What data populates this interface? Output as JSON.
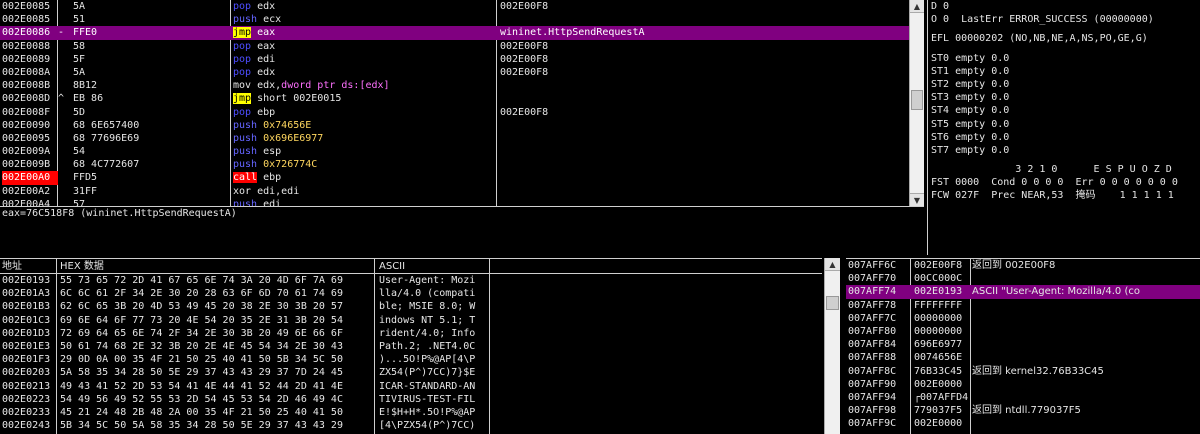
{
  "disasm": {
    "rows": [
      {
        "addr": "002E0085",
        "mark": "",
        "hex": "5A",
        "mnem": "pop",
        "kind": "pop",
        "ops": [
          {
            "t": " edx",
            "c": "plain"
          }
        ],
        "comment": "002E00F8"
      },
      {
        "addr": "002E0085",
        "mark": "",
        "hex": "51",
        "mnem": "push",
        "kind": "push",
        "ops": [
          {
            "t": " ecx",
            "c": "plain"
          }
        ],
        "comment": ""
      },
      {
        "addr": "002E0086",
        "mark": "-",
        "hex": "FFE0",
        "mnem": "jmp",
        "kind": "jmp",
        "ops": [
          {
            "t": " eax",
            "c": "plain"
          }
        ],
        "comment": "wininet.HttpSendRequestA",
        "selected": true
      },
      {
        "addr": "002E0088",
        "mark": "",
        "hex": "58",
        "mnem": "pop",
        "kind": "pop",
        "ops": [
          {
            "t": " eax",
            "c": "plain"
          }
        ],
        "comment": "002E00F8"
      },
      {
        "addr": "002E0089",
        "mark": "",
        "hex": "5F",
        "mnem": "pop",
        "kind": "pop",
        "ops": [
          {
            "t": " edi",
            "c": "plain"
          }
        ],
        "comment": "002E00F8"
      },
      {
        "addr": "002E008A",
        "mark": "",
        "hex": "5A",
        "mnem": "pop",
        "kind": "pop",
        "ops": [
          {
            "t": " edx",
            "c": "plain"
          }
        ],
        "comment": "002E00F8"
      },
      {
        "addr": "002E008B",
        "mark": "",
        "hex": "8B12",
        "mnem": "mov",
        "kind": "plain",
        "ops": [
          {
            "t": " edx,",
            "c": "plain"
          },
          {
            "t": "dword ptr ds:[edx]",
            "c": "mem"
          }
        ],
        "comment": ""
      },
      {
        "addr": "002E008D",
        "mark": "^",
        "hex": "EB 86",
        "mnem": "jmp",
        "kind": "jmp",
        "ops": [
          {
            "t": " short 002E0015",
            "c": "plain"
          }
        ],
        "comment": ""
      },
      {
        "addr": "002E008F",
        "mark": "",
        "hex": "5D",
        "mnem": "pop",
        "kind": "pop",
        "ops": [
          {
            "t": " ebp",
            "c": "plain"
          }
        ],
        "comment": "002E00F8"
      },
      {
        "addr": "002E0090",
        "mark": "",
        "hex": "68 6E657400",
        "mnem": "push",
        "kind": "push",
        "ops": [
          {
            "t": " 0x74656E",
            "c": "imm"
          }
        ],
        "comment": ""
      },
      {
        "addr": "002E0095",
        "mark": "",
        "hex": "68 77696E69",
        "mnem": "push",
        "kind": "push",
        "ops": [
          {
            "t": " 0x696E6977",
            "c": "imm"
          }
        ],
        "comment": ""
      },
      {
        "addr": "002E009A",
        "mark": "",
        "hex": "54",
        "mnem": "push",
        "kind": "push",
        "ops": [
          {
            "t": " esp",
            "c": "plain"
          }
        ],
        "comment": ""
      },
      {
        "addr": "002E009B",
        "mark": "",
        "hex": "68 4C772607",
        "mnem": "push",
        "kind": "push",
        "ops": [
          {
            "t": " 0x726774C",
            "c": "imm"
          }
        ],
        "comment": ""
      },
      {
        "addr": "002E00A0",
        "mark": "",
        "hex": "FFD5",
        "mnem": "call",
        "kind": "call",
        "ops": [
          {
            "t": " ebp",
            "c": "plain"
          }
        ],
        "comment": "",
        "addr_red": true
      },
      {
        "addr": "002E00A2",
        "mark": "",
        "hex": "31FF",
        "mnem": "xor",
        "kind": "plain",
        "ops": [
          {
            "t": " edi,edi",
            "c": "plain"
          }
        ],
        "comment": ""
      },
      {
        "addr": "002E00A4",
        "mark": "",
        "hex": "57",
        "mnem": "push",
        "kind": "push",
        "ops": [
          {
            "t": " edi",
            "c": "plain"
          }
        ],
        "comment": ""
      }
    ]
  },
  "info_line": "eax=76C518F8 (wininet.HttpSendRequestA)",
  "registers": {
    "lines_top": [
      "D 0",
      "O 0  LastErr ERROR_SUCCESS (00000000)"
    ],
    "efl": "EFL 00000202 (NO,NB,NE,A,NS,PO,GE,G)",
    "st": [
      "ST0 empty 0.0",
      "ST1 empty 0.0",
      "ST2 empty 0.0",
      "ST3 empty 0.0",
      "ST4 empty 0.0",
      "ST5 empty 0.0",
      "ST6 empty 0.0",
      "ST7 empty 0.0"
    ],
    "fpu_header": "              3 2 1 0      E S P U O Z D",
    "fst": "FST 0000  Cond 0 0 0 0  Err 0 0 0 0 0 0 0",
    "fcw_prefix": "FCW 027F  Prec NEAR,53  ",
    "fcw_mask_label": "掩码",
    "fcw_suffix": "    1 1 1 1 1"
  },
  "dump": {
    "header_addr": "地址",
    "header_hex": "HEX 数据",
    "header_ascii": "ASCII",
    "rows": [
      {
        "addr": "002E0193",
        "hex": "55 73 65 72 2D 41 67 65 6E 74 3A 20 4D 6F 7A 69",
        "ascii": "User-Agent: Mozi"
      },
      {
        "addr": "002E01A3",
        "hex": "6C 6C 61 2F 34 2E 30 20 28 63 6F 6D 70 61 74 69",
        "ascii": "lla/4.0 (compati"
      },
      {
        "addr": "002E01B3",
        "hex": "62 6C 65 3B 20 4D 53 49 45 20 38 2E 30 3B 20 57",
        "ascii": "ble; MSIE 8.0; W"
      },
      {
        "addr": "002E01C3",
        "hex": "69 6E 64 6F 77 73 20 4E 54 20 35 2E 31 3B 20 54",
        "ascii": "indows NT 5.1; T"
      },
      {
        "addr": "002E01D3",
        "hex": "72 69 64 65 6E 74 2F 34 2E 30 3B 20 49 6E 66 6F",
        "ascii": "rident/4.0; Info"
      },
      {
        "addr": "002E01E3",
        "hex": "50 61 74 68 2E 32 3B 20 2E 4E 45 54 34 2E 30 43",
        "ascii": "Path.2; .NET4.0C"
      },
      {
        "addr": "002E01F3",
        "hex": "29 0D 0A 00 35 4F 21 50 25 40 41 50 5B 34 5C 50",
        "ascii": ")...5O!P%@AP[4\\P"
      },
      {
        "addr": "002E0203",
        "hex": "5A 58 35 34 28 50 5E 29 37 43 43 29 37 7D 24 45",
        "ascii": "ZX54(P^)7CC)7}$E"
      },
      {
        "addr": "002E0213",
        "hex": "49 43 41 52 2D 53 54 41 4E 44 41 52 44 2D 41 4E",
        "ascii": "ICAR-STANDARD-AN"
      },
      {
        "addr": "002E0223",
        "hex": "54 49 56 49 52 55 53 2D 54 45 53 54 2D 46 49 4C",
        "ascii": "TIVIRUS-TEST-FIL"
      },
      {
        "addr": "002E0233",
        "hex": "45 21 24 48 2B 48 2A 00 35 4F 21 50 25 40 41 50",
        "ascii": "E!$H+H*.5O!P%@AP"
      },
      {
        "addr": "002E0243",
        "hex": "5B 34 5C 50 5A 58 35 34 28 50 5E 29 37 43 43 29",
        "ascii": "[4\\PZX54(P^)7CC)"
      }
    ]
  },
  "stack": {
    "rows": [
      {
        "addr": "007AFF6C",
        "val": "002E00F8",
        "com": "返回到 002E00F8"
      },
      {
        "addr": "007AFF70",
        "val": "00CC000C",
        "com": ""
      },
      {
        "addr": "007AFF74",
        "val": "002E0193",
        "com": "ASCII \"User-Agent: Mozilla/4.0 (co",
        "hl": true
      },
      {
        "addr": "007AFF78",
        "val": "FFFFFFFF",
        "com": ""
      },
      {
        "addr": "007AFF7C",
        "val": "00000000",
        "com": ""
      },
      {
        "addr": "007AFF80",
        "val": "00000000",
        "com": ""
      },
      {
        "addr": "007AFF84",
        "val": "696E6977",
        "com": ""
      },
      {
        "addr": "007AFF88",
        "val": "0074656E",
        "com": ""
      },
      {
        "addr": "007AFF8C",
        "val": "76B33C45",
        "com": "返回到 kernel32.76B33C45"
      },
      {
        "addr": "007AFF90",
        "val": "002E0000",
        "com": ""
      },
      {
        "addr": "007AFF94",
        "val": "┌007AFFD4",
        "com": ""
      },
      {
        "addr": "007AFF98",
        "val": "779037F5",
        "com": "返回到 ntdll.779037F5"
      },
      {
        "addr": "007AFF9C",
        "val": "002E0000",
        "com": ""
      }
    ]
  }
}
